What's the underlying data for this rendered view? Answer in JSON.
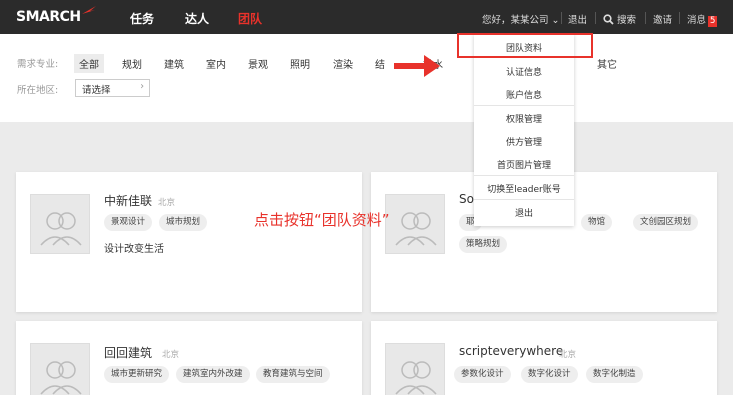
{
  "topbar": {
    "logo": "SMARCH",
    "nav": [
      "任务",
      "达人",
      "团队"
    ],
    "greeting": "您好，某某公司",
    "logout": "退出",
    "search": "搜索",
    "invite": "邀请",
    "messages": "消息",
    "message_count": "5"
  },
  "filters": {
    "specialty_label": "需求专业:",
    "specialties": [
      "全部",
      "规划",
      "建筑",
      "室内",
      "景观",
      "照明",
      "渲染",
      "结",
      "排水",
      "其它"
    ],
    "region_label": "所在地区:",
    "region_value": "请选择"
  },
  "dropdown": {
    "items": [
      "团队资料",
      "认证信息",
      "账户信息",
      "权限管理",
      "供方管理",
      "首页图片管理",
      "切换至leader账号",
      "退出"
    ]
  },
  "annotation": "点击按钮“团队资料”",
  "cards": [
    {
      "name": "中新佳联",
      "city": "北京",
      "tags": [
        "景观设计",
        "城市规划"
      ],
      "slogan": "设计改变生活"
    },
    {
      "name": "So",
      "city": "",
      "tags": [
        "耶",
        "物馆",
        "文创园区规划",
        "策略规划"
      ]
    },
    {
      "name": "回回建筑",
      "city": "北京",
      "tags": [
        "城市更新研究",
        "建筑室内外改建",
        "教育建筑与空间"
      ]
    },
    {
      "name": "scripteverywhere",
      "city": "北京",
      "tags": [
        "参数化设计",
        "数字化设计",
        "数字化制造"
      ]
    }
  ],
  "colors": {
    "accent": "#e8322b",
    "topbar": "#2b2b2b"
  }
}
